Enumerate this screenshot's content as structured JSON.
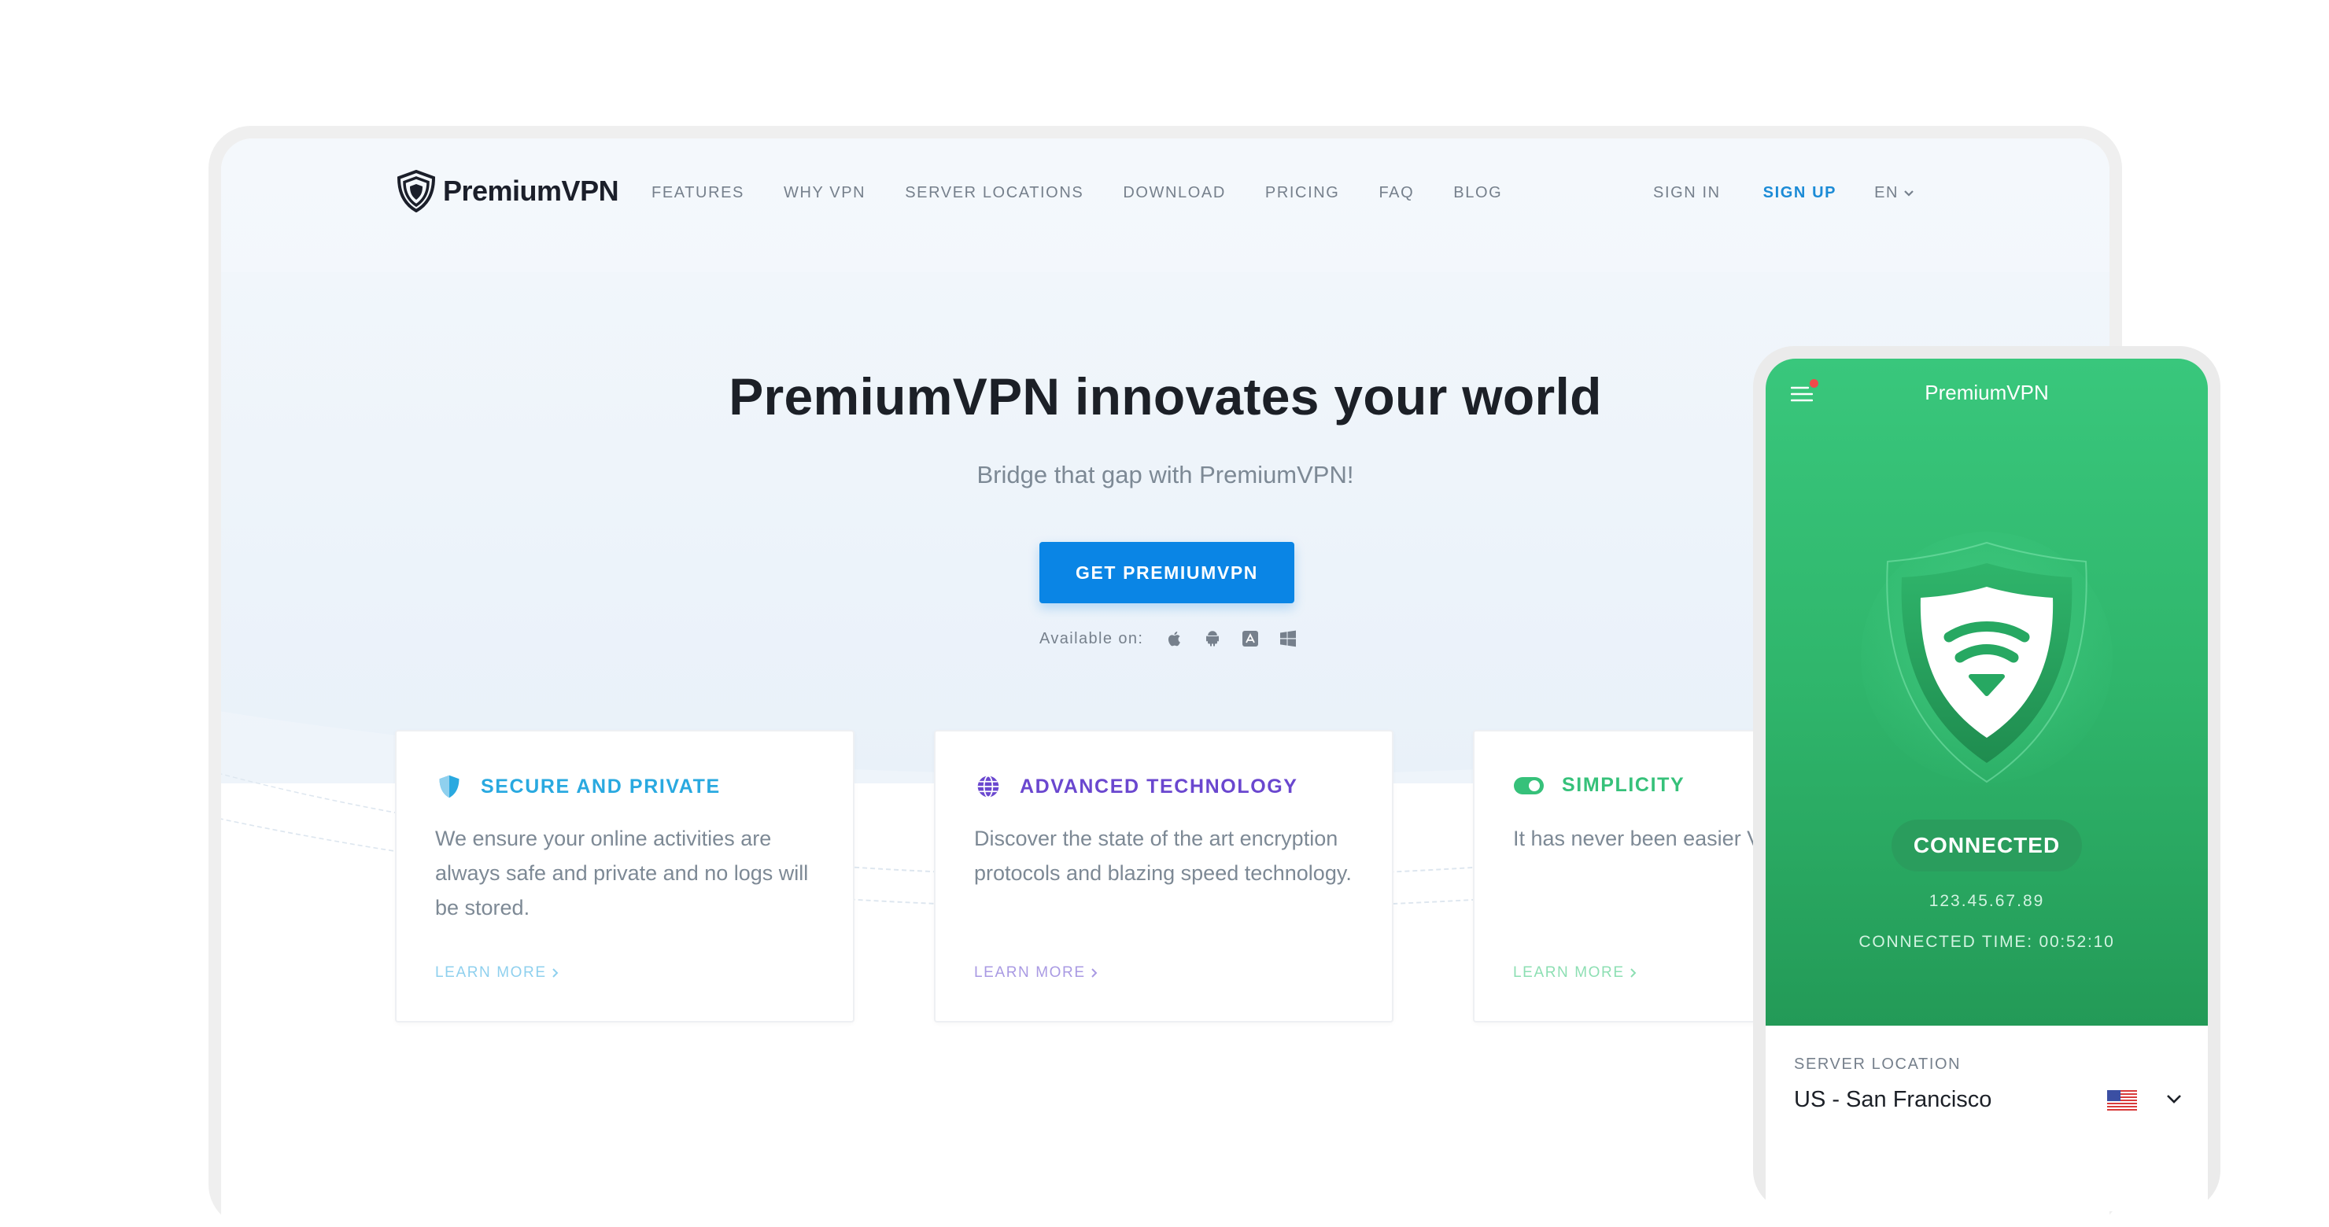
{
  "brand": {
    "name": "PremiumVPN"
  },
  "nav": {
    "links": [
      "FEATURES",
      "WHY VPN",
      "SERVER LOCATIONS",
      "DOWNLOAD",
      "PRICING",
      "FAQ",
      "BLOG"
    ],
    "sign_in": "SIGN IN",
    "sign_up": "SIGN UP",
    "language": "EN"
  },
  "hero": {
    "title": "PremiumVPN innovates your world",
    "subtitle": "Bridge that gap with PremiumVPN!",
    "cta": "GET PREMIUMVPN",
    "available_label": "Available on:",
    "platforms": [
      "apple-icon",
      "android-icon",
      "app-store-icon",
      "windows-icon"
    ]
  },
  "features": [
    {
      "icon": "shield-icon",
      "title": "SECURE AND PRIVATE",
      "body": "We ensure your online activities are always safe and private and no logs will be stored.",
      "link": "LEARN MORE",
      "color": "#29a9e0",
      "link_color": "#8fd0ee"
    },
    {
      "icon": "globe-icon",
      "title": "ADVANCED TECHNOLOGY",
      "body": "Discover the state of the art encryption protocols and blazing speed technology.",
      "link": "LEARN MORE",
      "color": "#6a47cf",
      "link_color": "#a99ae3"
    },
    {
      "icon": "toggle-icon",
      "title": "SIMPLICITY",
      "body": "It has never been easier VPN server.",
      "link": "LEARN MORE",
      "color": "#36c17a",
      "link_color": "#8ddfb3"
    }
  ],
  "phone": {
    "app_title": "PremiumVPN",
    "status": "CONNECTED",
    "ip": "123.45.67.89",
    "connected_time": "CONNECTED TIME: 00:52:10",
    "server_location_label": "SERVER LOCATION",
    "server_location": "US - San Francisco",
    "flag": "us-flag-icon"
  },
  "colors": {
    "accent": "#0a85e5",
    "signup": "#1b8bd6",
    "green": "#36c17a"
  }
}
